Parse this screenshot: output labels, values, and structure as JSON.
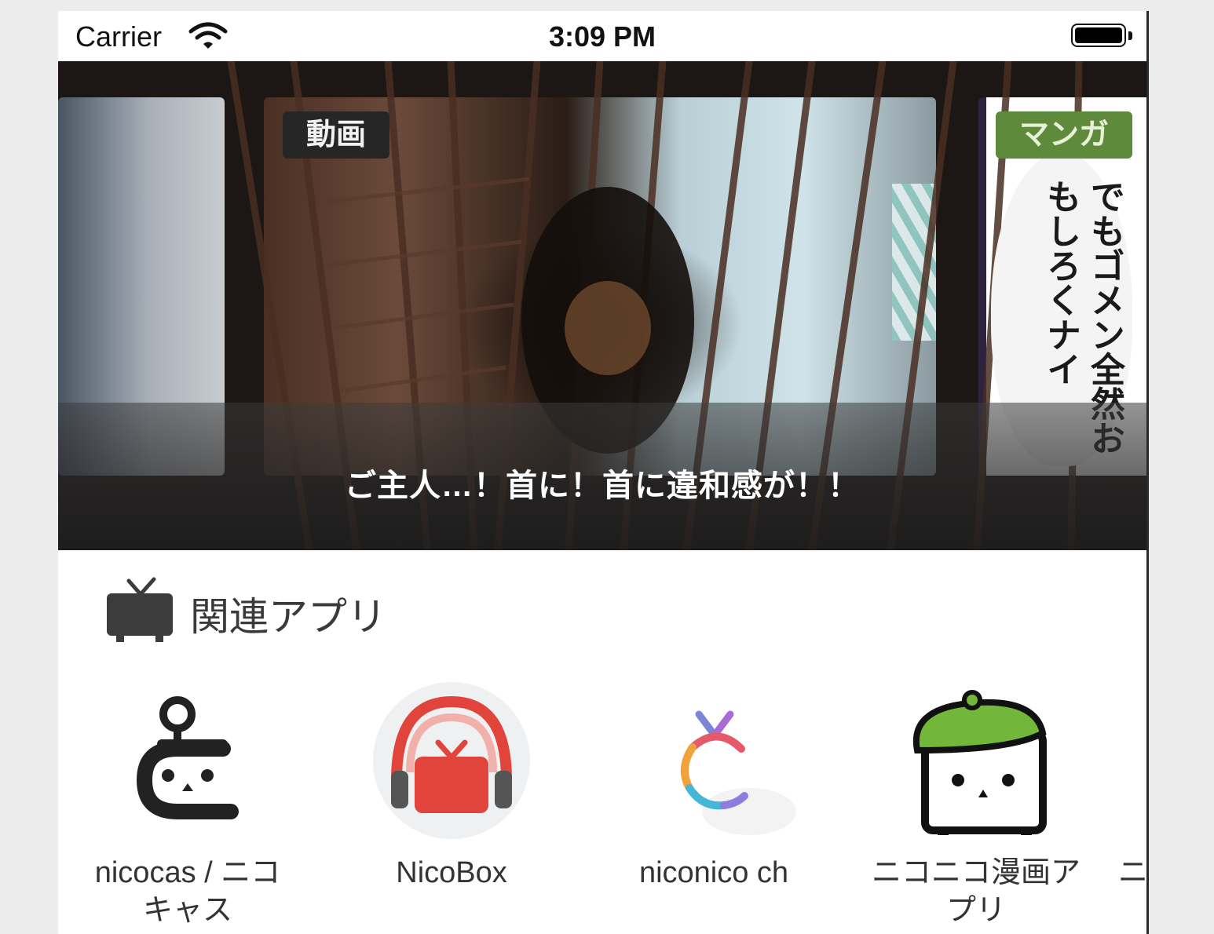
{
  "status_bar": {
    "carrier": "Carrier",
    "time": "3:09 PM",
    "battery_level": 1.0
  },
  "banner": {
    "left_card": {},
    "center_card": {
      "badge": "動画",
      "caption": "ご主人…！首に！首に違和感が！！"
    },
    "right_card": {
      "badge": "マンガ",
      "text": "でもゴメン全然おもしろくナイ"
    }
  },
  "related_apps": {
    "icon": "tv-icon",
    "title": "関連アプリ",
    "apps": [
      {
        "label_line1": "nicocas / ニコ",
        "label_line2": "キャス",
        "icon": "nicocas-robot-icon"
      },
      {
        "label_line1": "NicoBox",
        "label_line2": "",
        "icon": "nicobox-headphones-icon"
      },
      {
        "label_line1": "niconico ch",
        "label_line2": "",
        "icon": "niconico-ch-logo-icon"
      },
      {
        "label_line1": "ニコニコ漫画ア",
        "label_line2": "プリ",
        "icon": "niconico-manga-beret-icon"
      },
      {
        "label_line1": "ニ",
        "label_line2": "",
        "icon": ""
      }
    ]
  },
  "colors": {
    "manga_badge": "#5e8a3c",
    "video_badge": "#262626",
    "nicobox_red": "#e0443a"
  }
}
